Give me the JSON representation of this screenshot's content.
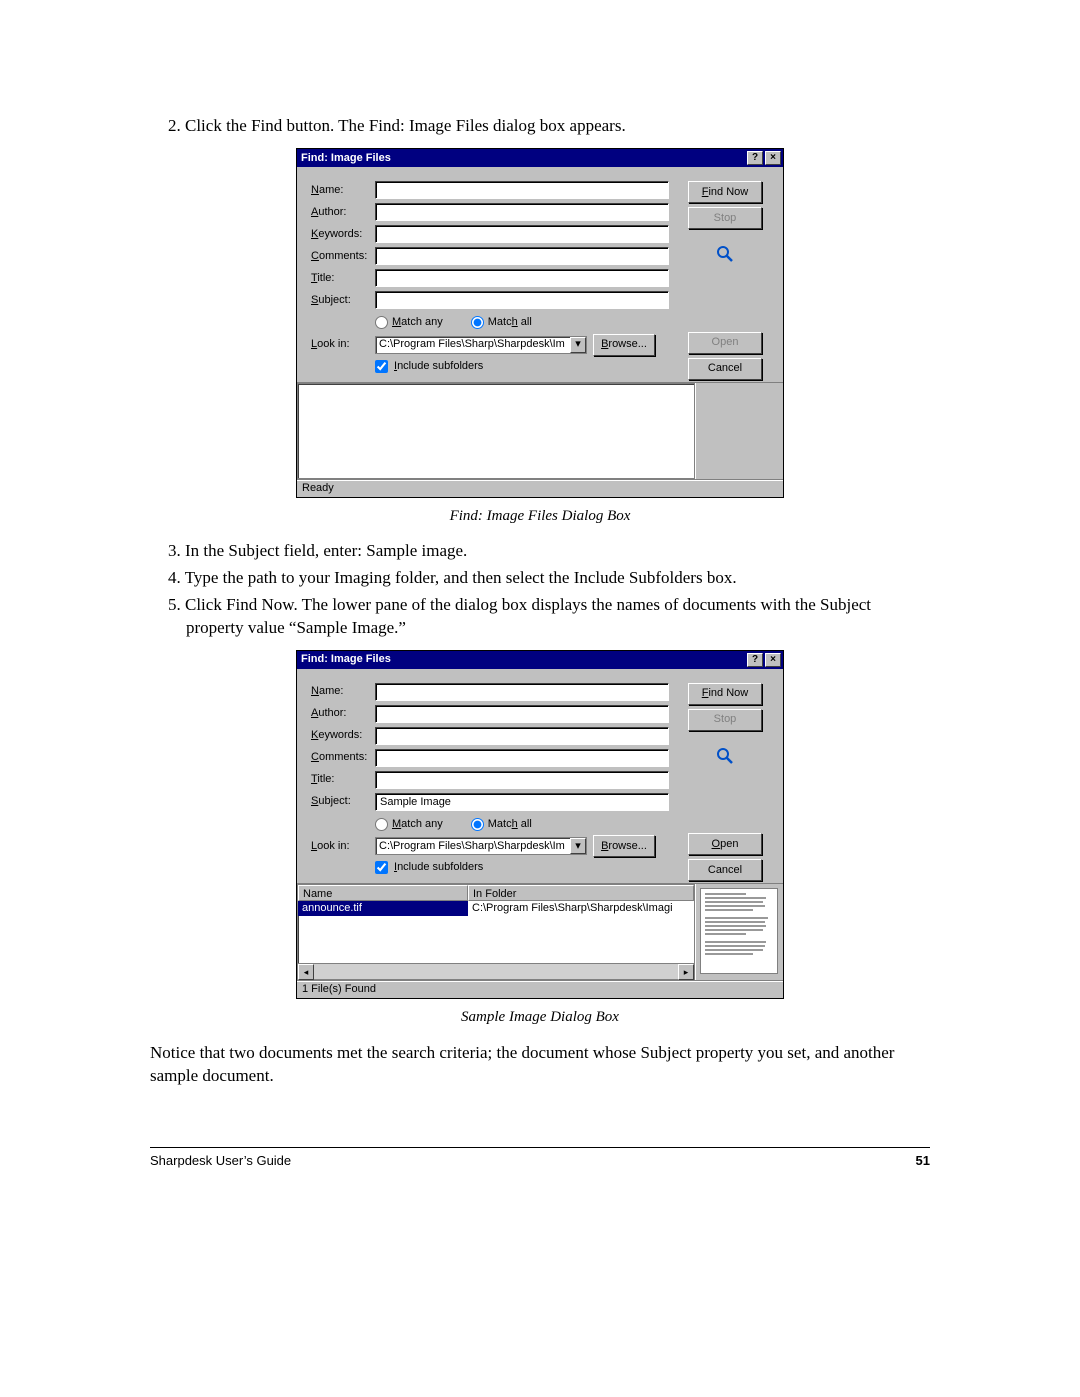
{
  "steps": {
    "s2": "2.  Click the Find button. The Find: Image Files dialog box appears.",
    "s3": "3.  In the Subject field, enter: Sample image.",
    "s4": "4.  Type the path to your Imaging folder, and then select the Include Subfolders box.",
    "s5": "5.  Click Find Now. The lower pane of the dialog box displays the names of documents with the Subject property value “Sample Image.”"
  },
  "captions": {
    "c1": "Find: Image Files Dialog Box",
    "c2": "Sample Image Dialog Box"
  },
  "post_text": "Notice that two documents met the search criteria; the document whose Subject property you set, and another sample document.",
  "footer": {
    "left": "Sharpdesk User’s Guide",
    "right": "51"
  },
  "dialog": {
    "title": "Find: Image Files",
    "labels": {
      "name": "Name:",
      "author": "Author:",
      "keywords": "Keywords:",
      "comments": "Comments:",
      "title": "Title:",
      "subject": "Subject:",
      "look_in": "Look in:"
    },
    "underline": {
      "name": "N",
      "author": "A",
      "keywords": "K",
      "comments": "C",
      "title": "T",
      "subject": "S",
      "match_any": "M",
      "match_all": "h",
      "look_in": "L",
      "browse": "B",
      "include": "I",
      "find_now": "F",
      "stop": "S",
      "open": "O",
      "cancel": "C"
    },
    "radios": {
      "match_any": "Match any",
      "match_all": "Match all"
    },
    "lookin_value": "C:\\Program Files\\Sharp\\Sharpdesk\\Im",
    "browse": "Browse...",
    "include_sub": "Include subfolders",
    "buttons": {
      "find_now": "Find Now",
      "stop": "Stop",
      "open": "Open",
      "cancel": "Cancel"
    },
    "status_ready": "Ready",
    "status_found": "1 File(s) Found",
    "subject2_value": "Sample Image",
    "results": {
      "col_name": "Name",
      "col_folder": "In Folder",
      "row_name": "announce.tif",
      "row_folder": "C:\\Program Files\\Sharp\\Sharpdesk\\Imagi"
    }
  }
}
